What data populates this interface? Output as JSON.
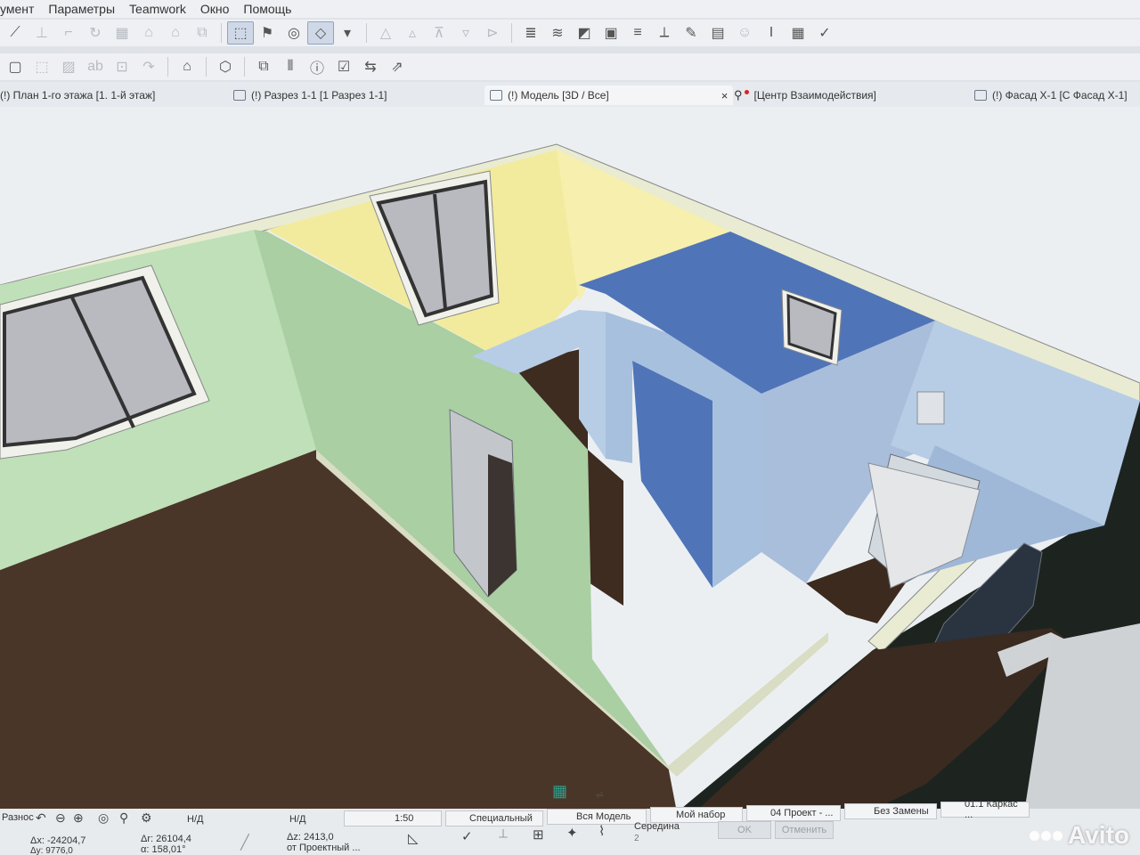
{
  "menu": [
    "умент",
    "Параметры",
    "Teamwork",
    "Окно",
    "Помощь"
  ],
  "tabs": [
    {
      "label": "(!) План 1-го этажа [1. 1-й этаж]"
    },
    {
      "label": "(!) Разрез 1-1 [1 Разрез 1-1]"
    },
    {
      "label": "(!) Модель [3D / Все]",
      "close": "×"
    },
    {
      "label": "[Центр Взаимодействия]"
    },
    {
      "label": "(!) Фасад Х-1 [С Фасад Х-1]"
    }
  ],
  "status": {
    "mode": "Разнос",
    "dx": "Δx: -24204,7",
    "dy": "Δy: 9776,0",
    "dr": "Δr: 26104,4",
    "angle": "α: 158,01°",
    "dz": "Δz: 2413,0",
    "ref": "от Проектный ...",
    "nd1": "Н/Д",
    "nd2": "Н/Д",
    "scale": "1:50",
    "layer_set": "Специальный",
    "model_view": "Вся Модель",
    "pen_set": "Мой набор",
    "project": "04 Проект - ...",
    "override": "Без Замены",
    "frame": "01.1 Каркас ...",
    "snap": "Середина",
    "snap_num": "2",
    "ok": "OK",
    "cancel": "Отменить"
  },
  "watermark": "Avito",
  "colors": {
    "wall_green": "#bfe0b8",
    "wall_yellow": "#f2eb9e",
    "wall_blue": "#b7cde6",
    "floor": "#4a3628",
    "bath_tile": "#5074b8",
    "exterior": "#1d2420",
    "active_tab": "#f4f5f7"
  }
}
